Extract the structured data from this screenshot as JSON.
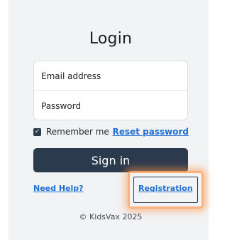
{
  "login": {
    "title": "Login",
    "email_placeholder": "Email address",
    "password_placeholder": "Password",
    "remember_label": "Remember me",
    "reset_link": "Reset password",
    "signin_label": "Sign in",
    "help_link": "Need Help?",
    "registration_link": "Registration",
    "copyright": "© KidsVax 2025"
  },
  "colors": {
    "primary": "#2c3a4d",
    "link": "#1f6fd1",
    "highlight": "#ff9a50"
  }
}
